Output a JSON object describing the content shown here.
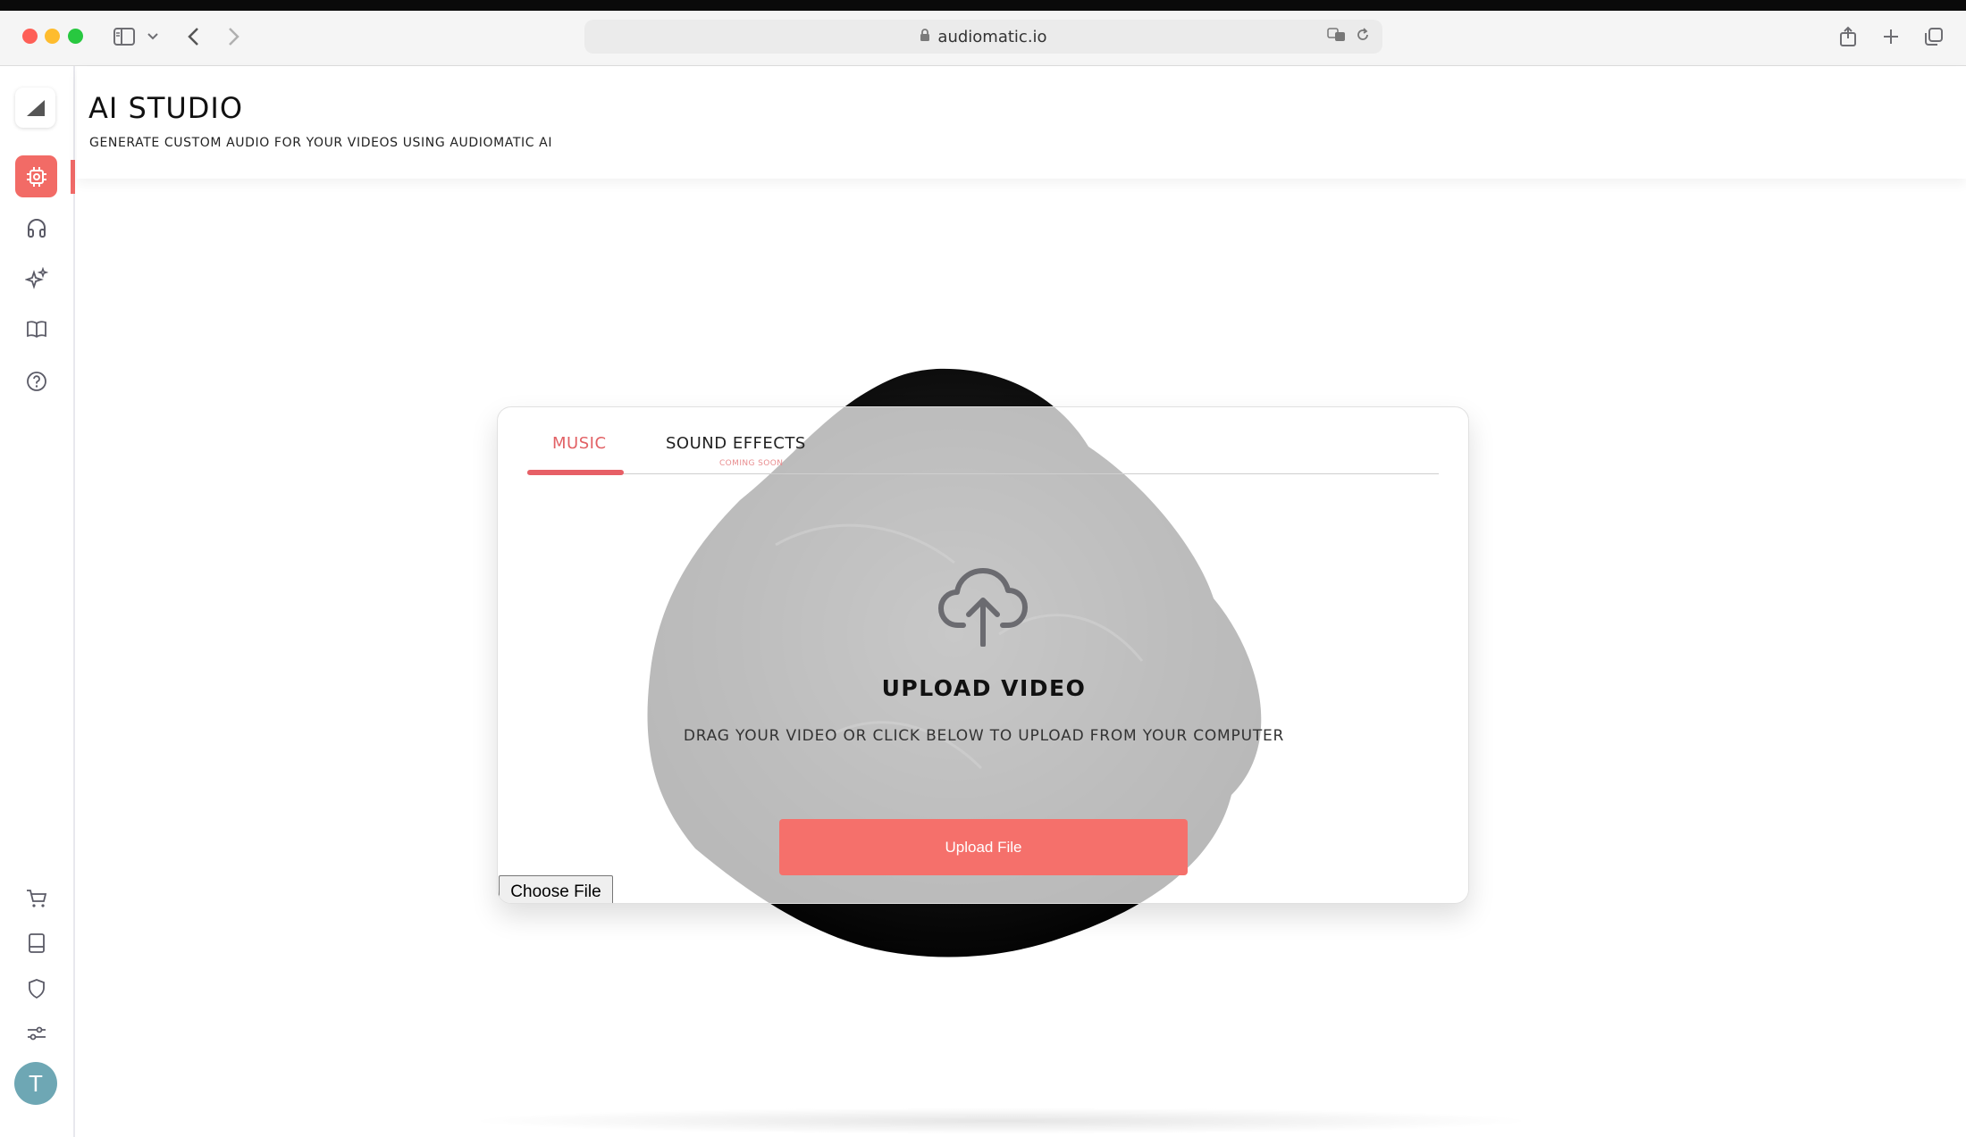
{
  "browser": {
    "url": "audiomatic.io"
  },
  "header": {
    "title": "AI STUDIO",
    "subtitle": "GENERATE CUSTOM AUDIO FOR YOUR VIDEOS USING AUDIOMATIC AI"
  },
  "sidebar": {
    "top_items": [
      {
        "name": "ai-studio",
        "icon": "chip-icon",
        "active": true
      },
      {
        "name": "listen",
        "icon": "headphones-icon",
        "active": false
      },
      {
        "name": "magic",
        "icon": "sparkles-icon",
        "active": false
      },
      {
        "name": "guide",
        "icon": "book-icon",
        "active": false
      },
      {
        "name": "help",
        "icon": "help-circle-icon",
        "active": false
      }
    ],
    "bottom_items": [
      {
        "name": "cart",
        "icon": "cart-icon"
      },
      {
        "name": "library",
        "icon": "tablet-icon"
      },
      {
        "name": "security",
        "icon": "shield-icon"
      },
      {
        "name": "settings",
        "icon": "sliders-icon"
      }
    ],
    "avatar_initial": "T"
  },
  "card": {
    "tabs": [
      {
        "label": "MUSIC",
        "active": true
      },
      {
        "label": "SOUND EFFECTS",
        "active": false,
        "badge": "COMING SOON"
      }
    ],
    "upload_title": "UPLOAD VIDEO",
    "upload_description": "DRAG YOUR VIDEO OR CLICK BELOW TO UPLOAD FROM YOUR COMPUTER",
    "upload_button_label": "Upload File",
    "choose_file_label": "Choose File"
  },
  "colors": {
    "accent": "#f26b66",
    "active_tab": "#e26165",
    "avatar": "#6ea7b4"
  }
}
